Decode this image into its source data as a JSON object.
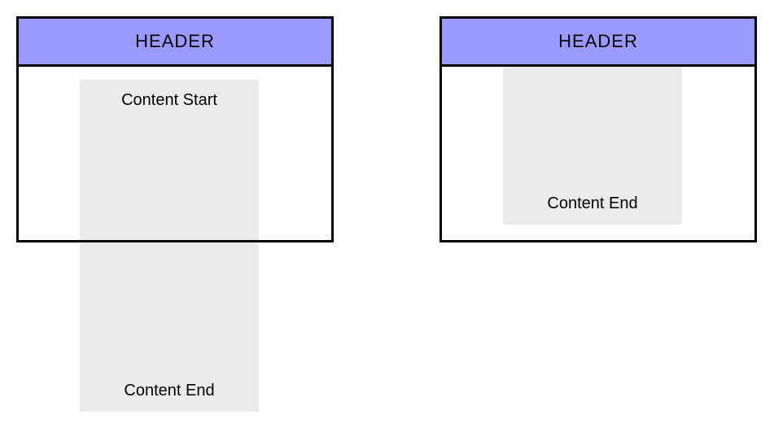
{
  "left": {
    "header": "HEADER",
    "content_start": "Content Start",
    "content_end": "Content End"
  },
  "right": {
    "header": "HEADER",
    "content_end": "Content End"
  },
  "colors": {
    "header_bg": "#9999ff",
    "content_bg": "#ebebeb",
    "border": "#000000"
  }
}
